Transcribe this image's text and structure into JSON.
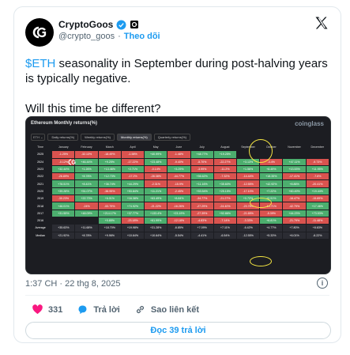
{
  "author": {
    "name": "CryptoGoos",
    "handle": "@crypto_goos",
    "separator": "·",
    "follow_label": "Theo dõi"
  },
  "tweet": {
    "cashtag": "$ETH",
    "line1_rest": " seasonality in September during post-halving years is typically negative.",
    "line2": "Will this time be different?"
  },
  "media": {
    "title": "Ethereum Monthly returns(%)",
    "brand": "coinglass",
    "selector": "ETH ⌄",
    "tabs": [
      "Daily returns(%)",
      "Weekly returns(%)",
      "Monthly returns(%)",
      "Quarterly returns(%)"
    ],
    "columns": [
      "Time",
      "January",
      "February",
      "March",
      "April",
      "May",
      "June",
      "July",
      "August",
      "September",
      "October",
      "November",
      "December"
    ],
    "rows": [
      {
        "cells": [
          "2025",
          "-1.25%",
          "-32.13%",
          "-18.49%",
          "-1.58%",
          "+40.99%",
          "-1.48%",
          "+48.77%",
          "+19.25%",
          "",
          "",
          "",
          ""
        ],
        "cls": [
          "y",
          "r",
          "r",
          "r",
          "r",
          "g",
          "r",
          "g",
          "g",
          "e",
          "e",
          "e",
          "e"
        ]
      },
      {
        "cells": [
          "2024",
          "-0.12%",
          "+46.44%",
          "+9.25%",
          "-17.22%",
          "+23.48%",
          "-9.40%",
          "-5.70%",
          "-22.27%",
          "+3.13%",
          "-3.4%",
          "+47.11%",
          "-9.73%"
        ],
        "cls": [
          "y",
          "r",
          "g",
          "g",
          "r",
          "g",
          "r",
          "r",
          "r",
          "g",
          "r",
          "g",
          "r"
        ]
      },
      {
        "cells": [
          "2023",
          "+32.44%",
          "+1.26%",
          "+13.46%",
          "+2.71%",
          "-0.14%",
          "+3.29%",
          "-3.99%",
          "-11.2%",
          "+1.56%",
          "+8.49%",
          "+13.53%",
          "+11.95%"
        ],
        "cls": [
          "y",
          "g",
          "g",
          "g",
          "g",
          "r",
          "g",
          "r",
          "r",
          "g",
          "g",
          "g",
          "g"
        ]
      },
      {
        "cells": [
          "2022",
          "-26.89%",
          "+8.78%",
          "+12.73%",
          "-17.2%",
          "-28.38%",
          "-44.77%",
          "+56.62%",
          "-7.32%",
          "-14.44%",
          "+18.35%",
          "-17.41%",
          "-7.6%"
        ],
        "cls": [
          "y",
          "r",
          "g",
          "g",
          "r",
          "r",
          "r",
          "g",
          "r",
          "r",
          "g",
          "r",
          "r"
        ]
      },
      {
        "cells": [
          "2021",
          "+78.51%",
          "+8.41%",
          "+36.74%",
          "+44.29%",
          "-2.31%",
          "-15.9%",
          "+11.16%",
          "+35.60%",
          "-12.55%",
          "+42.92%",
          "+8.86%",
          "-20.41%"
        ],
        "cls": [
          "y",
          "g",
          "g",
          "g",
          "g",
          "r",
          "r",
          "g",
          "g",
          "r",
          "g",
          "g",
          "r"
        ]
      },
      {
        "cells": [
          "2020",
          "+39.28%",
          "+51.07%",
          "-38.95%",
          "+53.84%",
          "+11.21%",
          "-2.45%",
          "+53.54%",
          "+25.15%",
          "-17.10%",
          "+7.22%",
          "+60.49%",
          "+19.44%"
        ],
        "cls": [
          "y",
          "g",
          "g",
          "r",
          "g",
          "g",
          "r",
          "g",
          "g",
          "r",
          "g",
          "g",
          "g"
        ]
      },
      {
        "cells": [
          "2019",
          "-30.23%",
          "+22.73%",
          "+6.01%",
          "+16.38%",
          "+63.49%",
          "+8.84%",
          "-34.77%",
          "-21.27%",
          "+0.72%",
          "+0.51%",
          "-16.47%",
          "-15.89%"
        ],
        "cls": [
          "y",
          "r",
          "g",
          "g",
          "g",
          "g",
          "g",
          "r",
          "r",
          "g",
          "g",
          "r",
          "r"
        ]
      },
      {
        "cells": [
          "2018",
          "+46.01%",
          "-24%",
          "-53.79%",
          "+74.92%",
          "-21.22%",
          "-16.26%",
          "-27.29%",
          "-24.40%",
          "-23.76%",
          "-14.71%",
          "-42.79%",
          "+17.46%"
        ],
        "cls": [
          "y",
          "g",
          "r",
          "r",
          "g",
          "r",
          "r",
          "r",
          "r",
          "r",
          "r",
          "r",
          "g"
        ]
      },
      {
        "cells": [
          "2017",
          "+31.55%",
          "+48.09%",
          "+214.17%",
          "+37.77%",
          "+133.4%",
          "+23.19%",
          "-27.39%",
          "+92.86%",
          "-21.65%",
          "-5.39%",
          "+44.23%",
          "+73.53%"
        ],
        "cls": [
          "y",
          "g",
          "g",
          "g",
          "g",
          "g",
          "g",
          "r",
          "g",
          "r",
          "r",
          "g",
          "g"
        ]
      },
      {
        "cells": [
          "2016",
          "",
          "",
          "+0.85%",
          "-23.18%",
          "+61.99%",
          "-12.18%",
          "-4.83%",
          "-7.14%",
          "-3.33%",
          "+6.81%",
          "-21.79%",
          "-11.48%"
        ],
        "cls": [
          "y",
          "e",
          "e",
          "g",
          "r",
          "g",
          "r",
          "r",
          "r",
          "r",
          "g",
          "r",
          "r"
        ]
      },
      {
        "cells": [
          "Average",
          "+35.63%",
          "+11.68%",
          "+18.70%",
          "+19.98%",
          "+31.28%",
          "-6.85%",
          "+7.09%",
          "+7.11%",
          "-6.42%",
          "+4.77%",
          "+7.80%",
          "+8.63%"
        ],
        "cls": [
          "y",
          "s",
          "s",
          "s",
          "s",
          "s",
          "s",
          "s",
          "s",
          "s",
          "s",
          "s",
          "s"
        ]
      },
      {
        "cells": [
          "Median",
          "+21.92%",
          "+8.78%",
          "+9.96%",
          "+10.64%",
          "+10.64%",
          "-5.54%",
          "-4.41%",
          "-6.54%",
          "-12.55%",
          "+5.33%",
          "+6.01%",
          "-6.22%"
        ],
        "cls": [
          "y",
          "s",
          "s",
          "s",
          "s",
          "s",
          "s",
          "s",
          "s",
          "s",
          "s",
          "s",
          "s"
        ]
      }
    ]
  },
  "meta": {
    "timestamp": "1:37 CH · 22 thg 8, 2025"
  },
  "actions": {
    "likes": "331",
    "reply_label": "Trả lời",
    "copy_link_label": "Sao liên kết"
  },
  "replies_button": "Đọc 39 trả lời",
  "colors": {
    "accent": "#1d9bf0",
    "like": "#f91880",
    "positive": "#4cae6e",
    "negative": "#d9534f",
    "highlight": "#f5e642"
  }
}
